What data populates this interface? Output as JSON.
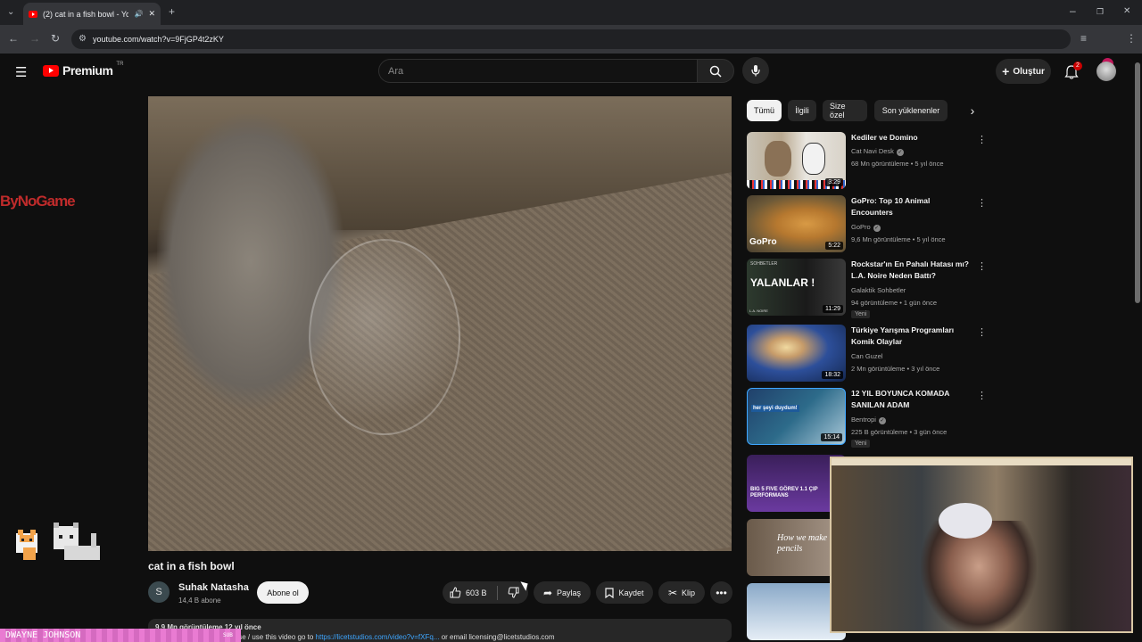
{
  "browser": {
    "tab_title": "(2) cat in a fish bowl - YouTube",
    "url": "youtube.com/watch?v=9FjGP4t2zKY"
  },
  "header": {
    "logo_text": "Premium",
    "logo_region": "TR",
    "search_placeholder": "Ara",
    "create_label": "Oluştur",
    "notification_count": "2"
  },
  "video": {
    "title": "cat in a fish bowl",
    "channel_initial": "S",
    "channel_name": "Suhak Natasha",
    "channel_subs": "14,4 B abone",
    "subscribe_label": "Abone ol",
    "likes": "603 B",
    "share_label": "Paylaş",
    "save_label": "Kaydet",
    "clip_label": "Klip",
    "description_top": "9,9 Mn görüntüleme  12 yıl önce",
    "description_text": "k / Licet Studios | *To license / use this video go to ",
    "description_link": "https://licetstudios.com/video?v=fXFq...",
    "description_tail": " or email licensing@licetstudios.com"
  },
  "chips": [
    "Tümü",
    "İlgili",
    "Size özel",
    "Son yüklenenler"
  ],
  "recommendations": [
    {
      "title": "Kediler ve Domino",
      "channel": "Cat Navi Desk",
      "verified": true,
      "meta": "68 Mn görüntüleme • 5 yıl önce",
      "duration": "3:29",
      "badge": ""
    },
    {
      "title": "GoPro: Top 10 Animal Encounters",
      "channel": "GoPro",
      "verified": true,
      "meta": "9,6 Mn görüntüleme • 5 yıl önce",
      "duration": "5:22",
      "badge": ""
    },
    {
      "title": "Rockstar'ın En Pahalı Hatası mı? L.A. Noire Neden Battı?",
      "channel": "Galaktik Sohbetler",
      "verified": false,
      "meta": "94 görüntüleme • 1 gün önce",
      "duration": "11:29",
      "badge": "Yeni"
    },
    {
      "title": "Türkiye Yarışma Programları Komik Olaylar",
      "channel": "Can Guzel",
      "verified": false,
      "meta": "2 Mn görüntüleme • 3 yıl önce",
      "duration": "18:32",
      "badge": ""
    },
    {
      "title": "12 YIL BOYUNCA KOMADA SANILAN ADAM",
      "channel": "Bentropi",
      "verified": true,
      "meta": "225 B görüntüleme • 3 gün önce",
      "duration": "15:14",
      "badge": "Yeni"
    }
  ],
  "thumb_texts": {
    "gopro": "GoPro",
    "yalanlar": "YALANLAR !",
    "sohbetler": "SOHBETLER",
    "lanoire": "L.A. NOIRE",
    "hersey": "her şeyi duydum!",
    "bigfive": "BIG 5 FIVE GÖREV 1.1 ÇIP PERFORMANS",
    "pencils": "How we make pencils"
  },
  "overlay": {
    "logo": "ByNoGame",
    "ticker": "DWAYNE JOHNSON",
    "ticker_sub": "SUB"
  },
  "colors": {
    "background": "#0f0f0f",
    "accent_red": "#ff0000",
    "link": "#3ea6ff"
  }
}
